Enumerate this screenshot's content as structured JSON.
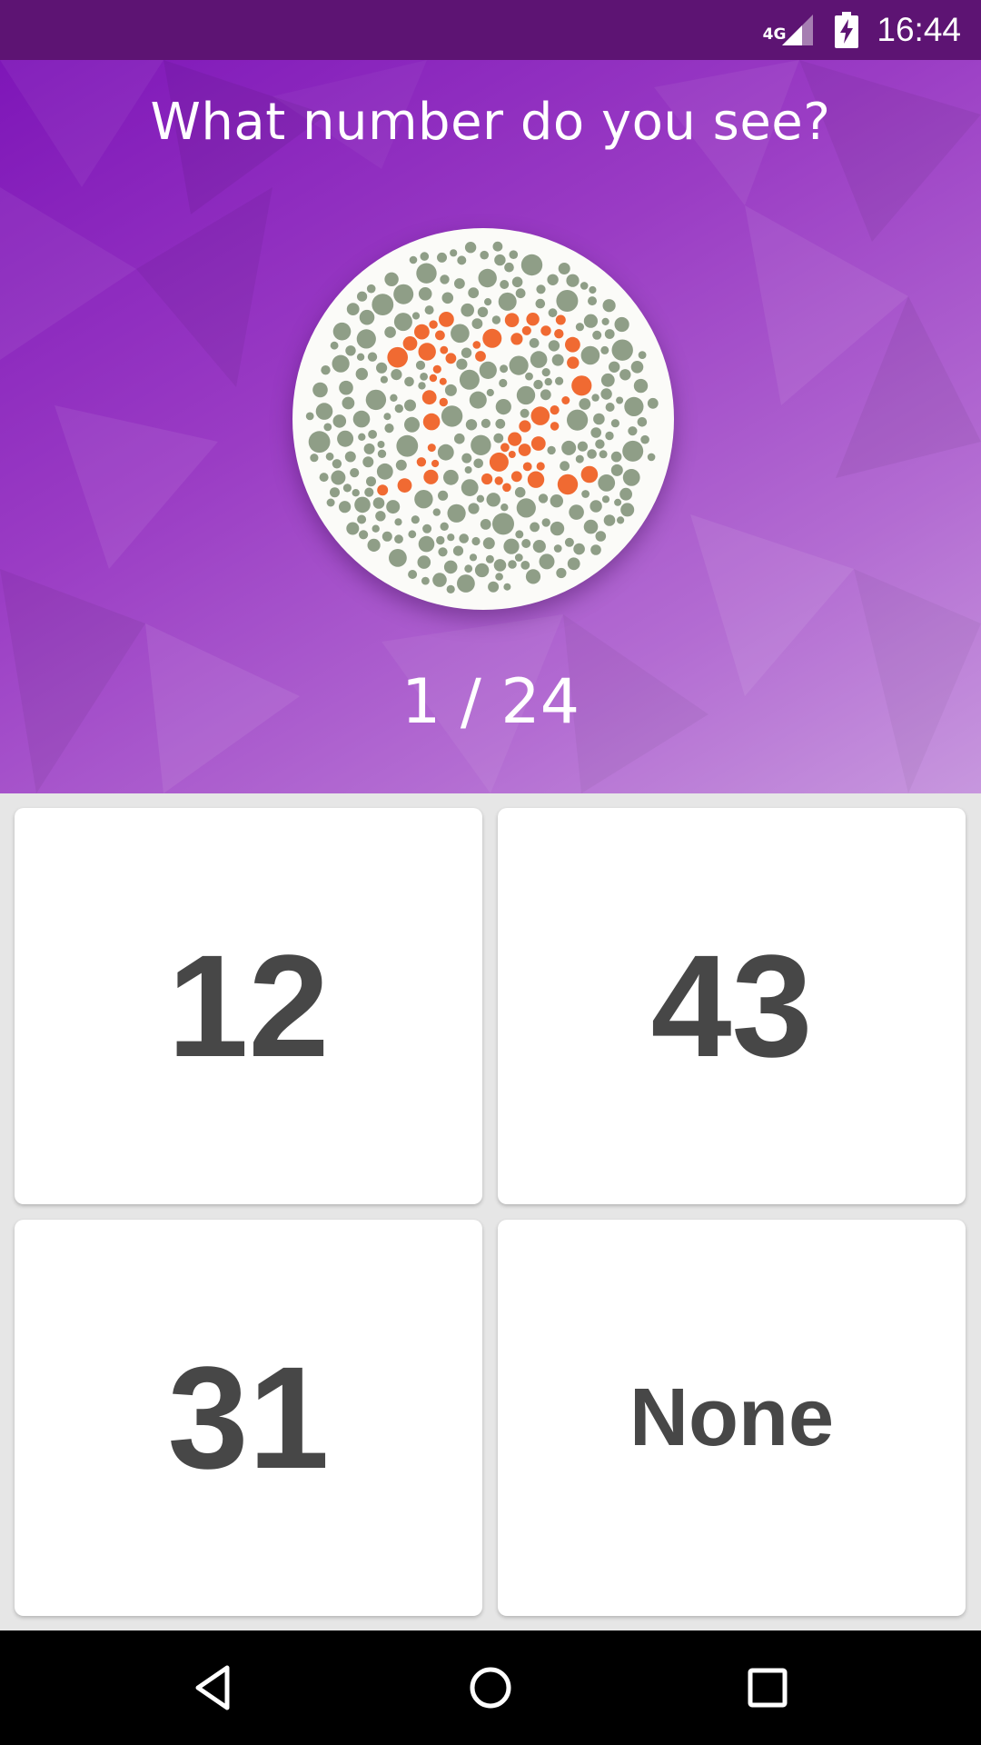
{
  "status_bar": {
    "network": "4G",
    "time": "16:44",
    "icons": [
      "signal-icon",
      "battery-charging-icon"
    ]
  },
  "quiz": {
    "question": "What number do you see?",
    "progress": "1 / 24",
    "plate_number": "12",
    "plate_colors": {
      "background_dots": "#8f9e87",
      "figure_dots": "#f06a32"
    }
  },
  "answers": [
    "12",
    "43",
    "31",
    "None"
  ],
  "nav": {
    "icons": [
      "back-icon",
      "home-icon",
      "recent-apps-icon"
    ]
  },
  "colors": {
    "status_bar": "#5d1473",
    "hero_start": "#7e16b8",
    "hero_end": "#c797de",
    "answer_text": "#474747",
    "answers_background": "#e6e6e6"
  }
}
